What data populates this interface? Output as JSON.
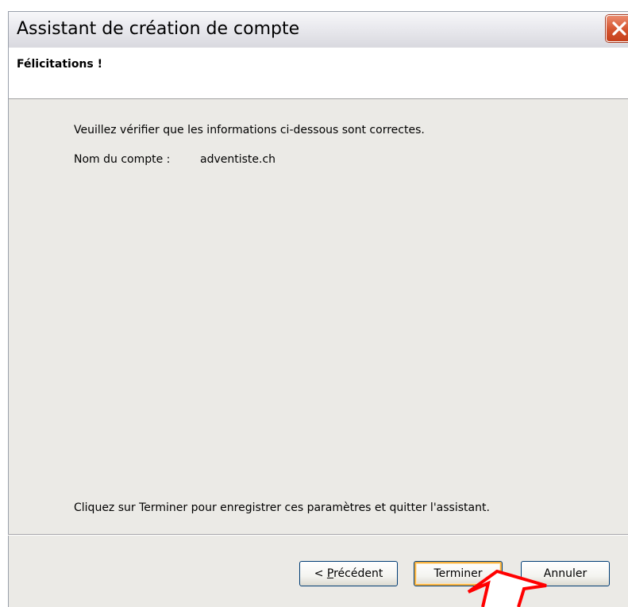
{
  "window": {
    "title": "Assistant de création de compte"
  },
  "header": {
    "title": "Félicitations !"
  },
  "content": {
    "verify_text": "Veuillez vérifier que les informations ci-dessous sont correctes.",
    "account_label": "Nom du compte :",
    "account_value": "adventiste.ch",
    "finish_text": "Cliquez sur Terminer pour enregistrer ces paramètres et quitter l'assistant."
  },
  "buttons": {
    "prev_prefix": "< ",
    "prev_mnemonic": "P",
    "prev_rest": "récédent",
    "finish": "Terminer",
    "cancel": "Annuler"
  },
  "icons": {
    "close": "close-icon",
    "annotation": "red-arrow-annotation"
  },
  "colors": {
    "close_button": "#d4542f",
    "content_background": "#ebeae6",
    "focus_ring": "#f8b23f",
    "annotation": "#ff0000"
  }
}
